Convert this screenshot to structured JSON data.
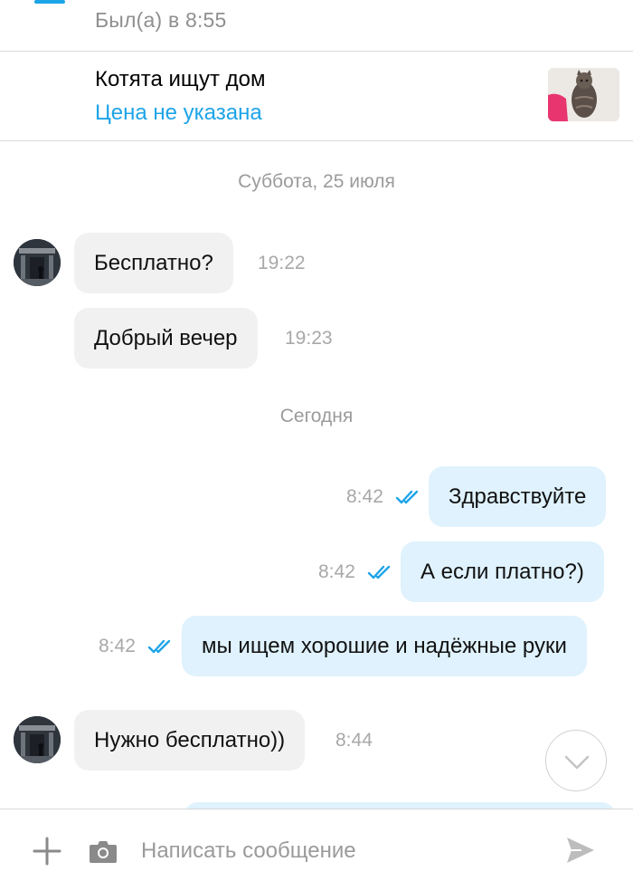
{
  "header": {
    "status": "Был(а) в 8:55",
    "back_icon": "arrow-left-icon"
  },
  "ad": {
    "title": "Котята ищут дом",
    "price": "Цена не указана"
  },
  "chat": {
    "separators": [
      "Суббота, 25 июля",
      "Сегодня"
    ],
    "messages": [
      {
        "text": "Бесплатно?",
        "time": "19:22",
        "direction": "in"
      },
      {
        "text": "Добрый вечер",
        "time": "19:23",
        "direction": "in"
      },
      {
        "text": "Здравствуйте",
        "time": "8:42",
        "direction": "out",
        "read": true
      },
      {
        "text": "А если платно?)",
        "time": "8:42",
        "direction": "out",
        "read": true
      },
      {
        "text": "мы ищем хорошие и надёжные руки",
        "time": "8:42",
        "direction": "out",
        "read": true
      },
      {
        "text": "Нужно бесплатно))",
        "time": "8:44",
        "direction": "in"
      }
    ]
  },
  "composer": {
    "placeholder": "Написать сообщение",
    "icons": [
      "plus-icon",
      "camera-icon",
      "send-icon"
    ]
  },
  "colors": {
    "accent": "#1da4e8",
    "incoming_bubble": "#f1f1f1",
    "outgoing_bubble": "#dff2fd",
    "timestamp": "#a8a8a8"
  }
}
